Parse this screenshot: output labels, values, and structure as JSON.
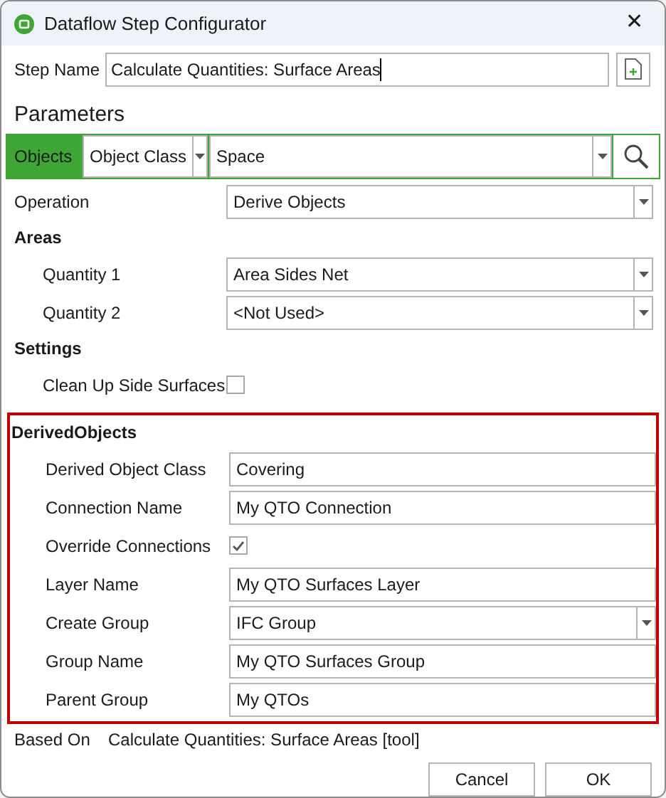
{
  "window": {
    "title": "Dataflow Step Configurator",
    "close": "✕"
  },
  "step_name": {
    "label": "Step Name",
    "value": "Calculate Quantities: Surface Areas"
  },
  "parameters_heading": "Parameters",
  "objects_bar": {
    "label": "Objects",
    "class_dropdown": "Object Class",
    "value_dropdown": "Space"
  },
  "sections": [
    {
      "rows": [
        {
          "kind": "dropdown",
          "label": "Operation",
          "value": "Derive Objects",
          "indented": false
        }
      ]
    },
    {
      "heading": "Areas",
      "rows": [
        {
          "kind": "dropdown",
          "label": "Quantity 1",
          "value": "Area Sides Net",
          "indented": true
        },
        {
          "kind": "dropdown",
          "label": "Quantity 2",
          "value": "<Not Used>",
          "indented": true
        }
      ]
    },
    {
      "heading": "Settings",
      "rows": [
        {
          "kind": "checkbox",
          "label": "Clean Up Side Surfaces",
          "checked": false,
          "indented": true
        }
      ]
    },
    {
      "heading": "DerivedObjects",
      "highlighted": true,
      "rows": [
        {
          "kind": "text",
          "label": "Derived Object Class",
          "value": "Covering",
          "indented": true
        },
        {
          "kind": "text",
          "label": "Connection Name",
          "value": "My QTO Connection",
          "indented": true
        },
        {
          "kind": "checkbox",
          "label": "Override Connections",
          "checked": true,
          "indented": true
        },
        {
          "kind": "text",
          "label": "Layer Name",
          "value": "My QTO Surfaces Layer",
          "indented": true
        },
        {
          "kind": "dropdown",
          "label": "Create Group",
          "value": "IFC Group",
          "indented": true
        },
        {
          "kind": "text",
          "label": "Group Name",
          "value": "My QTO Surfaces Group",
          "indented": true
        },
        {
          "kind": "text",
          "label": "Parent Group",
          "value": "My QTOs",
          "indented": true
        }
      ]
    }
  ],
  "based_on": {
    "label": "Based On",
    "value": "Calculate Quantities: Surface Areas [tool]"
  },
  "buttons": [
    "Cancel",
    "OK"
  ]
}
